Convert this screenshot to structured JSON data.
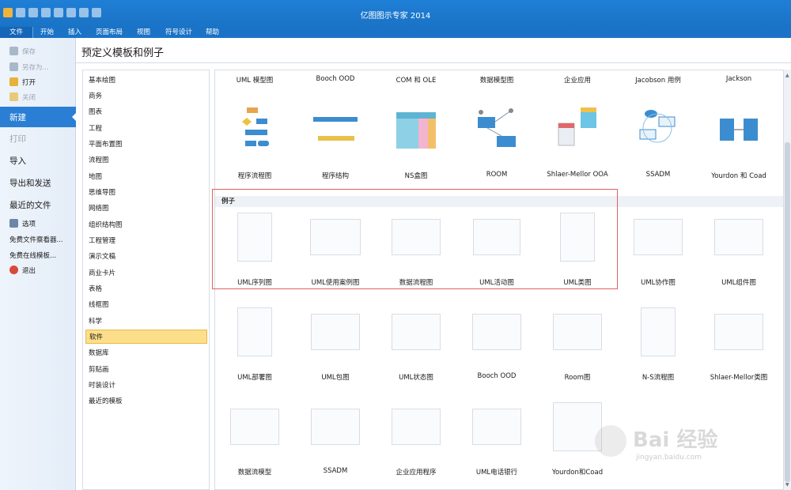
{
  "app": {
    "title": "亿图图示专家 2014"
  },
  "ribbon": {
    "tabs": [
      "文件",
      "开始",
      "插入",
      "页面布局",
      "视图",
      "符号设计",
      "帮助"
    ]
  },
  "backstage": {
    "items": [
      {
        "label": "保存",
        "type": "small",
        "dim": true,
        "icon": "save-icon"
      },
      {
        "label": "另存为...",
        "type": "small",
        "dim": true,
        "icon": "save-as-icon"
      },
      {
        "label": "打开",
        "type": "small",
        "dim": false,
        "icon": "open-icon"
      },
      {
        "label": "关闭",
        "type": "small",
        "dim": true,
        "icon": "close-file-icon"
      },
      {
        "label": "新建",
        "type": "big",
        "active": true
      },
      {
        "label": "打印",
        "type": "big",
        "dim": true
      },
      {
        "label": "导入",
        "type": "big"
      },
      {
        "label": "导出和发送",
        "type": "big"
      },
      {
        "label": "最近的文件",
        "type": "big"
      },
      {
        "label": "选项",
        "type": "small",
        "icon": "options-icon"
      },
      {
        "label": "免费文件察看器...",
        "type": "small"
      },
      {
        "label": "免费在线模板...",
        "type": "small"
      },
      {
        "label": "退出",
        "type": "small",
        "icon": "exit-icon"
      }
    ]
  },
  "main": {
    "title": "预定义模板和例子",
    "categories": [
      "基本绘图",
      "商务",
      "图表",
      "工程",
      "平面布置图",
      "流程图",
      "地图",
      "思维导图",
      "网络图",
      "组织结构图",
      "工程管理",
      "演示文稿",
      "商业卡片",
      "表格",
      "线框图",
      "科学",
      "软件",
      "数据库",
      "剪贴画",
      "时装设计",
      "最近的模板"
    ],
    "selected_category": "软件",
    "templates_header": [
      "UML 模型图",
      "Booch OOD",
      "COM 和 OLE",
      "数据模型图",
      "企业应用",
      "Jacobson 用例",
      "Jackson"
    ],
    "templates": [
      "程序流程图",
      "程序结构",
      "NS盒图",
      "ROOM",
      "Shlaer-Mellor OOA",
      "SSADM",
      "Yourdon 和 Coad"
    ],
    "examples_title": "例子",
    "examples_row1": [
      "UML序列图",
      "UML使用案例图",
      "数据流程图",
      "UML活动图",
      "UML类图",
      "UML协作图",
      "UML组件图"
    ],
    "examples_row2": [
      "UML部署图",
      "UML包图",
      "UML状态图",
      "Booch OOD",
      "Room图",
      "N-S流程图",
      "Shlaer-Mellor类图"
    ],
    "examples_row3": [
      "数据流模型",
      "SSADM",
      "企业应用程序",
      "UML电话银行",
      "Yourdon和Coad"
    ]
  },
  "watermark": {
    "brand": "Bai 经验",
    "url": "jingyan.baidu.com"
  },
  "colors": {
    "accent": "#1a73c6",
    "active_nav": "#2a7fd4",
    "selected_cat": "#fdde8a",
    "highlight_box": "#e06060"
  }
}
